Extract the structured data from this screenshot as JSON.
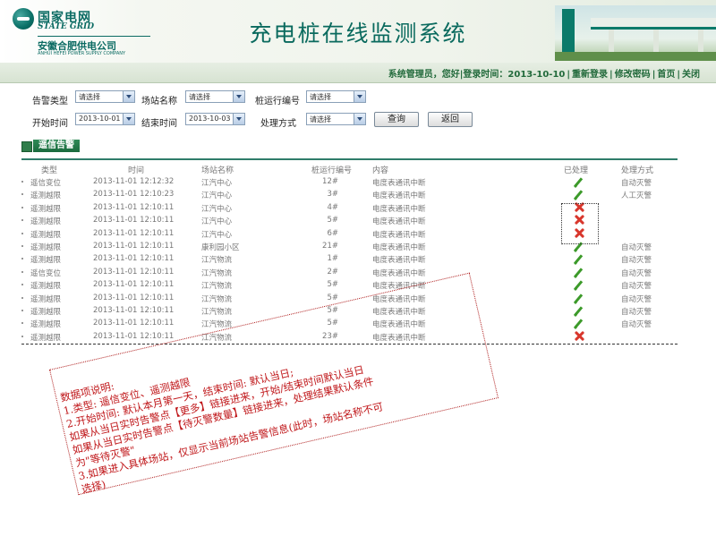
{
  "header": {
    "logo_cn": "国家电网",
    "logo_en": "STATE GRID",
    "logo_sub": "安徽合肥供电公司",
    "logo_sub_en": "ANHUI HEFEI POWER SUPPLY COMPANY",
    "app_title": "充电桩在线监测系统"
  },
  "topbar": {
    "user_info": "系统管理员，您好|登录时间：2013-10-10",
    "links": [
      "重新登录",
      "修改密码",
      "首页",
      "关闭"
    ]
  },
  "filters": {
    "alarm_type_label": "告警类型",
    "alarm_type_value": "请选择",
    "station_label": "场站名称",
    "station_value": "请选择",
    "pile_label": "桩运行编号",
    "pile_value": "请选择",
    "start_label": "开始时间",
    "start_value": "2013-10-01",
    "end_label": "结束时间",
    "end_value": "2013-10-03",
    "process_label": "处理方式",
    "process_value": "请选择",
    "query_button": "查询",
    "back_button": "返回"
  },
  "section": {
    "title": "遥信告警"
  },
  "table": {
    "headers": [
      "类型",
      "时间",
      "场站名称",
      "桩运行编号",
      "内容",
      "已处理",
      "处理方式"
    ],
    "rows": [
      {
        "type": "遥信变位",
        "time": "2013-11-01 12:12:32",
        "station": "江汽中心",
        "pile": "12#",
        "content": "电度表通讯中断",
        "handled": true,
        "method": "自动灭警"
      },
      {
        "type": "遥测越限",
        "time": "2013-11-01 12:10:23",
        "station": "江汽中心",
        "pile": "3#",
        "content": "电度表通讯中断",
        "handled": true,
        "method": "人工灭警"
      },
      {
        "type": "遥测越限",
        "time": "2013-11-01 12:10:11",
        "station": "江汽中心",
        "pile": "4#",
        "content": "电度表通讯中断",
        "handled": false,
        "method": ""
      },
      {
        "type": "遥测越限",
        "time": "2013-11-01 12:10:11",
        "station": "江汽中心",
        "pile": "5#",
        "content": "电度表通讯中断",
        "handled": false,
        "method": ""
      },
      {
        "type": "遥测越限",
        "time": "2013-11-01 12:10:11",
        "station": "江汽中心",
        "pile": "6#",
        "content": "电度表通讯中断",
        "handled": false,
        "method": ""
      },
      {
        "type": "遥测越限",
        "time": "2013-11-01 12:10:11",
        "station": "康利园小区",
        "pile": "21#",
        "content": "电度表通讯中断",
        "handled": true,
        "method": "自动灭警"
      },
      {
        "type": "遥测越限",
        "time": "2013-11-01 12:10:11",
        "station": "江汽物流",
        "pile": "1#",
        "content": "电度表通讯中断",
        "handled": true,
        "method": "自动灭警"
      },
      {
        "type": "遥信变位",
        "time": "2013-11-01 12:10:11",
        "station": "江汽物流",
        "pile": "2#",
        "content": "电度表通讯中断",
        "handled": true,
        "method": "自动灭警"
      },
      {
        "type": "遥测越限",
        "time": "2013-11-01 12:10:11",
        "station": "江汽物流",
        "pile": "5#",
        "content": "电度表通讯中断",
        "handled": true,
        "method": "自动灭警"
      },
      {
        "type": "遥测越限",
        "time": "2013-11-01 12:10:11",
        "station": "江汽物流",
        "pile": "5#",
        "content": "电度表通讯中断",
        "handled": true,
        "method": "自动灭警"
      },
      {
        "type": "遥测越限",
        "time": "2013-11-01 12:10:11",
        "station": "江汽物流",
        "pile": "5#",
        "content": "电度表通讯中断",
        "handled": true,
        "method": "自动灭警"
      },
      {
        "type": "遥测越限",
        "time": "2013-11-01 12:10:11",
        "station": "江汽物流",
        "pile": "5#",
        "content": "电度表通讯中断",
        "handled": true,
        "method": "自动灭警"
      },
      {
        "type": "遥测越限",
        "time": "2013-11-01 12:10:11",
        "station": "江汽物流",
        "pile": "23#",
        "content": "电度表通讯中断",
        "handled": false,
        "method": ""
      }
    ]
  },
  "note": {
    "lines": [
      "数据项说明:",
      "1.类型: 遥信变位、遥测越限",
      "2.开始时间: 默认本月第一天，结束时间: 默认当日;",
      "   如果从当日实时告警点【更多】链接进来，开始/结束时间默认当日",
      "   如果从当日实时告警点【待灭警数量】链接进来，处理结果默认条件",
      "为\"等待灭警\"",
      "3.如果进入具体场站，仅显示当前场站告警信息(此时，场站名称不可",
      "选择)"
    ]
  },
  "colors": {
    "brand_green": "#0a6a5e",
    "handled_green": "#3c9a2a",
    "unhandled_red": "#d8362c",
    "note_red": "#c0181b"
  }
}
